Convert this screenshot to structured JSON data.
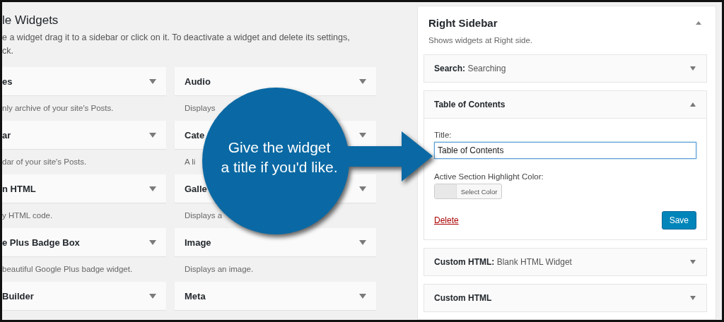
{
  "available_widgets": {
    "title": "le Widgets",
    "description_lines": [
      "e a widget drag it to a sidebar or click on it. To deactivate a widget and delete its settings,",
      "ck."
    ],
    "widgets": [
      {
        "name": "es",
        "description": "nly archive of your site's Posts."
      },
      {
        "name": "Audio",
        "description": "Displays"
      },
      {
        "name": "ar",
        "description": "dar of your site's Posts."
      },
      {
        "name": "Cate",
        "description": "A li"
      },
      {
        "name": "n HTML",
        "description": "y HTML code."
      },
      {
        "name": "Galle",
        "description": "Displays a"
      },
      {
        "name": "e Plus Badge Box",
        "description": "beautiful Google Plus badge widget."
      },
      {
        "name": "Image",
        "description": "Displays an image."
      },
      {
        "name": "Builder"
      },
      {
        "name": "Meta"
      }
    ]
  },
  "right_sidebar": {
    "title": "Right Sidebar",
    "expanded": true,
    "description": "Shows widgets at Right side.",
    "widgets": [
      {
        "name": "Search:",
        "subtitle": "Searching",
        "expanded": false
      },
      {
        "name": "Table of Contents",
        "expanded": true,
        "form": {
          "title_label": "Title:",
          "title_value": "Table of Contents",
          "color_label": "Active Section Highlight Color:",
          "color_button": "Select Color",
          "delete_link": "Delete",
          "save_button": "Save"
        }
      },
      {
        "name": "Custom HTML:",
        "subtitle": "Blank HTML Widget",
        "expanded": false
      },
      {
        "name": "Custom HTML",
        "expanded": false
      }
    ]
  },
  "callout": {
    "lines": [
      "Give the widget",
      "a title if you'd like."
    ]
  }
}
